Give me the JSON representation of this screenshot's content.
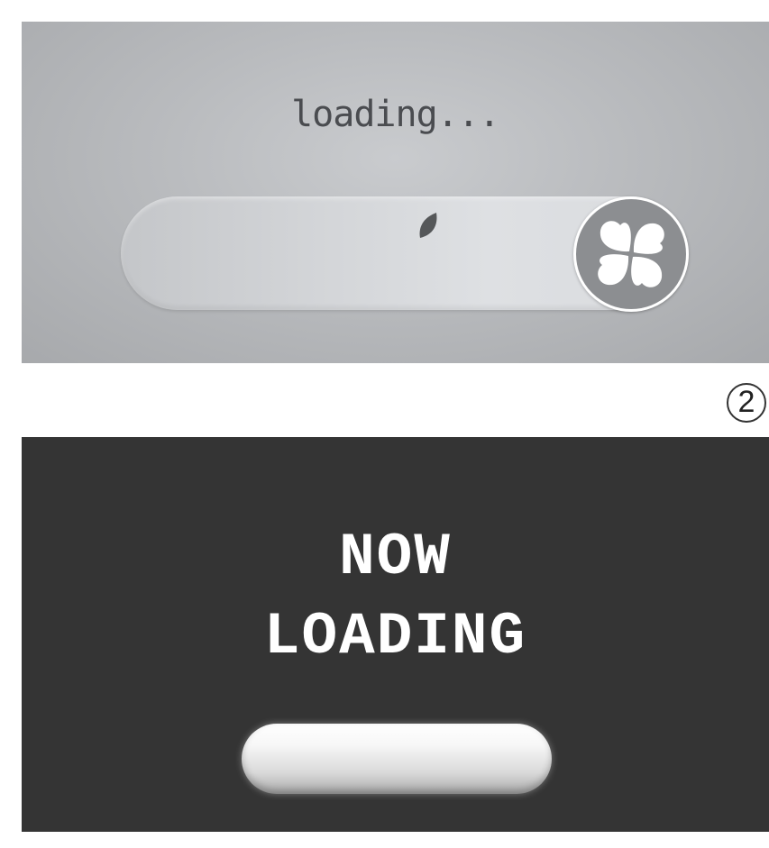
{
  "panel1": {
    "loading_text": "loading...",
    "background": "#b9bbbe",
    "track_color": "#d6d8db",
    "knob_color": "#8c8e91",
    "icons": [
      "leaf-icon",
      "four-leaf-clover-icon"
    ]
  },
  "step_badge": "②",
  "panel2": {
    "title_line1": "NOW",
    "title_line2": "LOADING",
    "background": "#343434",
    "text_color": "#ffffff"
  }
}
